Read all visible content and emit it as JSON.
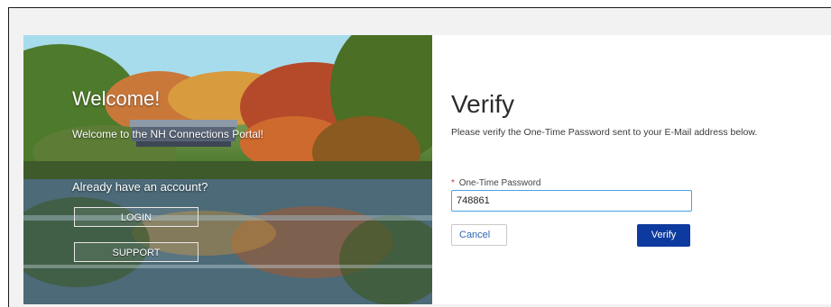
{
  "hero": {
    "title": "Welcome!",
    "subtitle": "Welcome to the NH Connections Portal!",
    "account_question": "Already have an account?",
    "login_label": "LOGIN",
    "support_label": "SUPPORT"
  },
  "verify": {
    "title": "Verify",
    "description": "Please verify the One-Time Password sent to your E-Mail address below.",
    "otp_label": "One-Time Password",
    "required_marker": "*",
    "otp_value": "748861",
    "cancel_label": "Cancel",
    "verify_label": "Verify"
  },
  "colors": {
    "accent_blue": "#0d3a9e",
    "link_blue": "#2f67b5",
    "focus_border": "#4aa3df",
    "required_red": "#c23934"
  }
}
